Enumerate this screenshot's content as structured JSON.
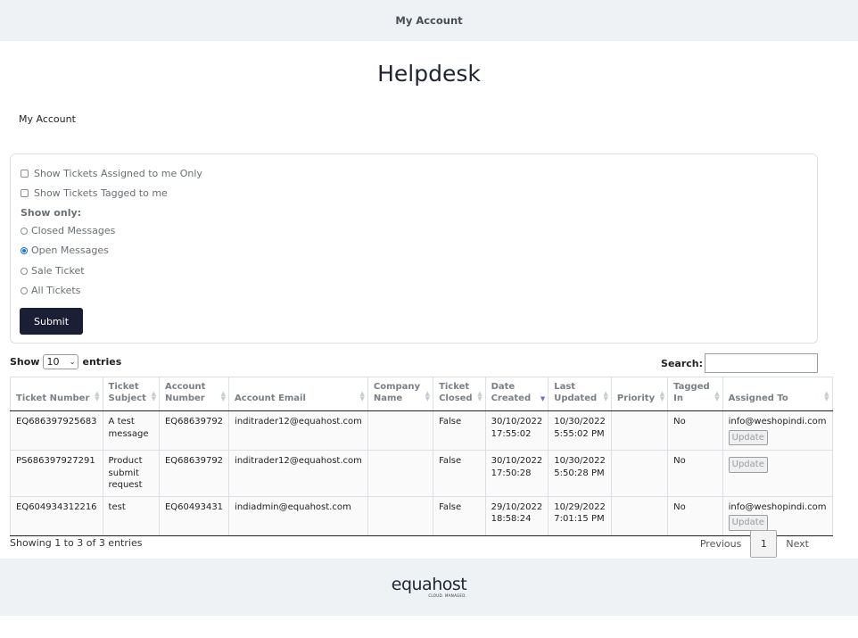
{
  "topbar": {
    "title": "My Account"
  },
  "page": {
    "title": "Helpdesk",
    "breadcrumb": "My Account"
  },
  "filters": {
    "checkboxes": [
      {
        "label": "Show Tickets Assigned to me Only",
        "checked": false
      },
      {
        "label": "Show Tickets Tagged to me",
        "checked": false
      }
    ],
    "show_only_label": "Show only:",
    "radios": [
      {
        "label": "Closed Messages",
        "selected": false
      },
      {
        "label": "Open Messages",
        "selected": true
      },
      {
        "label": "Sale Ticket",
        "selected": false
      },
      {
        "label": "All Tickets",
        "selected": false
      }
    ],
    "submit_label": "Submit"
  },
  "table_controls": {
    "show_label": "Show",
    "entries_value": "10",
    "entries_label": "entries",
    "search_label": "Search:",
    "search_value": ""
  },
  "table": {
    "columns": [
      {
        "line1": "",
        "line2": "Ticket Number"
      },
      {
        "line1": "Ticket",
        "line2": "Subject"
      },
      {
        "line1": "Account",
        "line2": "Number"
      },
      {
        "line1": "",
        "line2": "Account Email"
      },
      {
        "line1": "Company",
        "line2": "Name"
      },
      {
        "line1": "Ticket",
        "line2": "Closed"
      },
      {
        "line1": "Date",
        "line2": "Created",
        "sorted": true
      },
      {
        "line1": "Last",
        "line2": "Updated"
      },
      {
        "line1": "",
        "line2": "Priority"
      },
      {
        "line1": "Tagged",
        "line2": "In"
      },
      {
        "line1": "",
        "line2": "Assigned To"
      }
    ],
    "rows": [
      {
        "ticket_number": "EQ686397925683",
        "subject": [
          "A test",
          "message"
        ],
        "account_number": "EQ68639792",
        "email": "inditrader12@equahost.com",
        "company": "",
        "closed": "False",
        "created": [
          "30/10/2022",
          "17:55:02"
        ],
        "updated": [
          "10/30/2022",
          "5:55:02 PM"
        ],
        "priority": "",
        "tagged": "No",
        "assigned": "info@weshopindi.com",
        "update_label": "Update"
      },
      {
        "ticket_number": "PS686397927291",
        "subject": [
          "Product",
          "submit",
          "request"
        ],
        "account_number": "EQ68639792",
        "email": "inditrader12@equahost.com",
        "company": "",
        "closed": "False",
        "created": [
          "30/10/2022",
          "17:50:28"
        ],
        "updated": [
          "10/30/2022",
          "5:50:28 PM"
        ],
        "priority": "",
        "tagged": "No",
        "assigned": "",
        "update_label": "Update"
      },
      {
        "ticket_number": "EQ604934312216",
        "subject": [
          "test"
        ],
        "account_number": "EQ60493431",
        "email": "indiadmin@equahost.com",
        "company": "",
        "closed": "False",
        "created": [
          "29/10/2022",
          "18:58:24"
        ],
        "updated": [
          "10/29/2022",
          "7:01:15 PM"
        ],
        "priority": "",
        "tagged": "No",
        "assigned": "info@weshopindi.com",
        "update_label": "Update"
      }
    ]
  },
  "pagination": {
    "info": "Showing 1 to 3 of 3 entries",
    "previous": "Previous",
    "current": "1",
    "next": "Next"
  },
  "footer": {
    "logo_text": "equahost",
    "logo_tagline": "CLOUD. MANAGED."
  },
  "colors": {
    "primary_button": "#1a1f36",
    "topbar_bg": "#eef2f5",
    "radio_selected": "#1a73e8"
  }
}
